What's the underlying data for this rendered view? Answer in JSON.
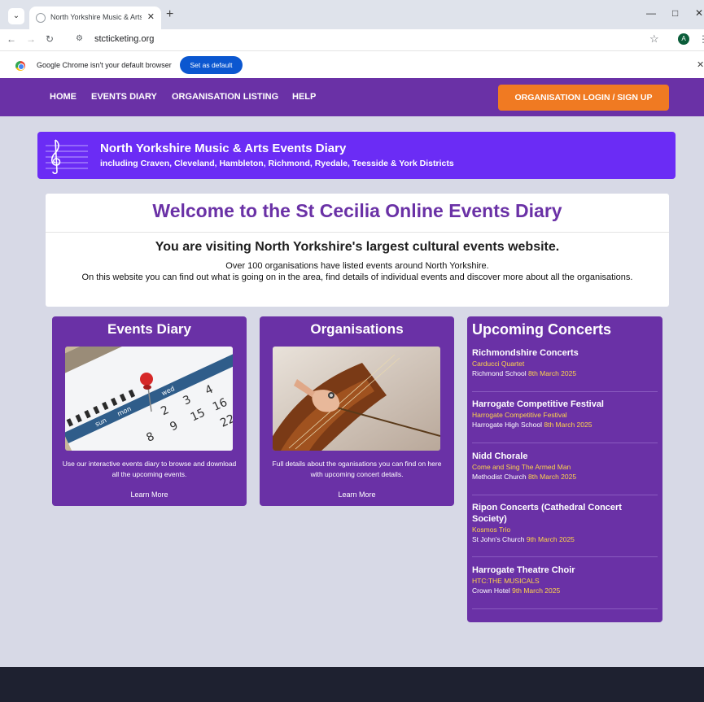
{
  "browser": {
    "tab_title": "North Yorkshire Music & Arts Ev",
    "url": "stcticketing.org",
    "profile_initial": "A",
    "infobar_text": "Google Chrome isn't your default browser",
    "set_default_label": "Set as default"
  },
  "nav": {
    "items": [
      "HOME",
      "EVENTS DIARY",
      "ORGANISATION LISTING",
      "HELP"
    ],
    "login_label": "ORGANISATION LOGIN / SIGN UP"
  },
  "banner": {
    "title": "North Yorkshire Music & Arts Events Diary",
    "subtitle": "including Craven, Cleveland, Hambleton, Richmond, Ryedale, Teesside & York Districts"
  },
  "welcome": {
    "title": "Welcome to the St Cecilia Online Events Diary",
    "lead": "You are visiting North Yorkshire's largest cultural events website.",
    "line1": "Over 100 organisations have listed events around North Yorkshire.",
    "line2": "On this website you can find out what is going on in the area, find details of individual events and discover more about all the organisations."
  },
  "cards": [
    {
      "title": "Events Diary",
      "text": "Use our interactive events diary to browse and download all the upcoming events.",
      "link": "Learn More"
    },
    {
      "title": "Organisations",
      "text": "Full details about the oganisations you can find on here with upcoming concert details.",
      "link": "Learn More"
    }
  ],
  "upcoming": {
    "title": "Upcoming Concerts",
    "concerts": [
      {
        "org": "Richmondshire Concerts",
        "event": "Carducci Quartet",
        "venue": "Richmond School",
        "date": "8th March 2025"
      },
      {
        "org": "Harrogate Competitive Festival",
        "event": "Harrogate Competitive Festival",
        "venue": "Harrogate High School",
        "date": "8th March 2025"
      },
      {
        "org": "Nidd Chorale",
        "event": "Come and Sing The Armed Man",
        "venue": "Methodist Church",
        "date": "8th March 2025"
      },
      {
        "org": "Ripon Concerts (Cathedral Concert Society)",
        "event": "Kosmos Trio",
        "venue": "St John's Church",
        "date": "9th March 2025"
      },
      {
        "org": "Harrogate Theatre Choir",
        "event": "HTC:THE MUSICALS",
        "venue": "Crown Hotel",
        "date": "9th March 2025"
      }
    ]
  },
  "calendar_text": {
    "sun": "sun",
    "mon": "mon",
    "wed": "wed",
    "n2": "2",
    "n3": "3",
    "n4": "4",
    "n8": "8",
    "n9": "9",
    "n15": "15",
    "n16": "16",
    "n22": "22"
  },
  "colors": {
    "brand_purple": "#6a31a6",
    "banner_violet": "#6b2cf5",
    "accent_orange": "#f07a22",
    "highlight_yellow": "#ffd54a"
  }
}
